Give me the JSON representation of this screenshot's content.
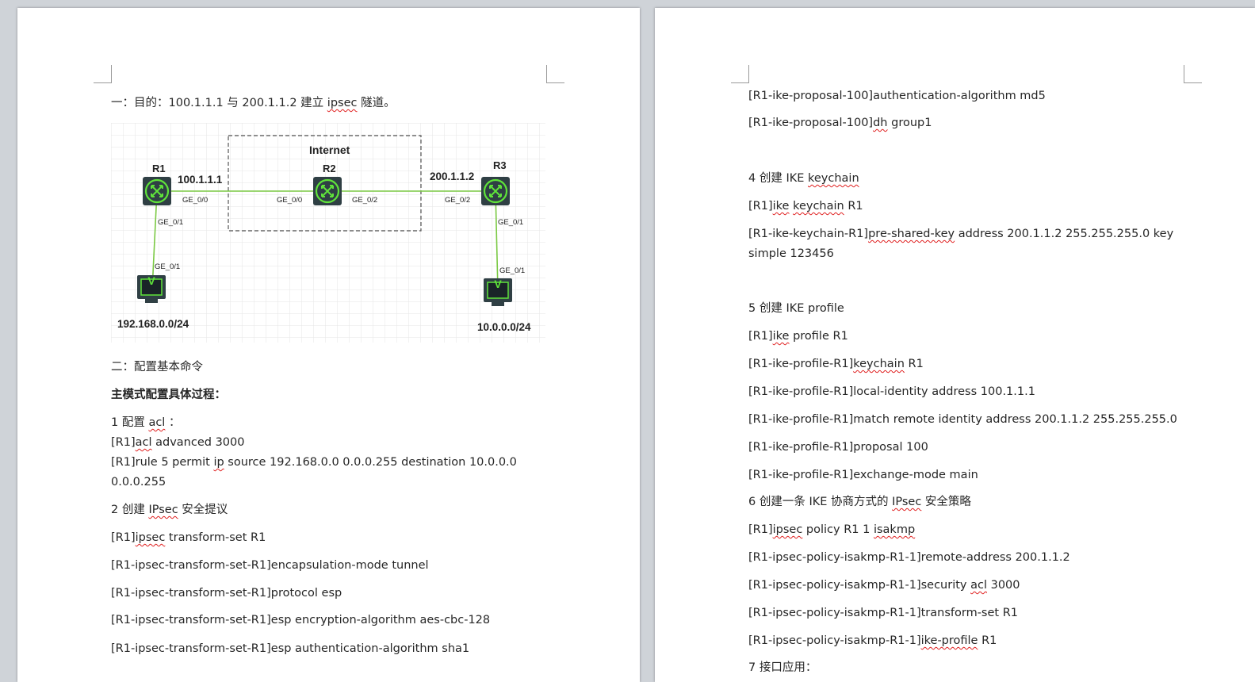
{
  "left_page": {
    "heading1": "一：目的：100.1.1.1 与 200.1.1.2 建立 ipsec 隧道。",
    "heading1_pre": "一：目的：100.1.1.1 与 200.1.1.2 建立 ",
    "heading1_word": "ipsec",
    "heading1_post": " 隧道。",
    "diagram": {
      "internet_label": "Internet",
      "routers": [
        {
          "name": "R1",
          "ip": "100.1.1.1"
        },
        {
          "name": "R2",
          "ip": ""
        },
        {
          "name": "R3",
          "ip": "200.1.1.2"
        }
      ],
      "port_labels": {
        "r1_up": "GE_0/0",
        "r2_left": "GE_0/0",
        "r2_right": "GE_0/2",
        "r3_up": "GE_0/2",
        "r1_down": "GE_0/1",
        "pc1_up": "GE_0/1",
        "r3_down": "GE_0/1",
        "pc2_up": "GE_0/1"
      },
      "pc_glyph": "V",
      "networks": [
        "192.168.0.0/24",
        "10.0.0.0/24"
      ]
    },
    "heading2": "二：配置基本命令",
    "heading3": "主模式配置具体过程：",
    "step1_pre": "1 配置 ",
    "step1_word": "acl",
    "step1_post": " ：",
    "cmd_acl_pre": "[R1]",
    "cmd_acl_word": "acl",
    "cmd_acl_post": " advanced  3000",
    "cmd_rule_pre": "[R1]rule 5 permit   ",
    "cmd_rule_word": "ip",
    "cmd_rule_post": " source 192.168.0.0 0.0.0.255 destination 10.0.0.0",
    "cmd_rule_cont": "0.0.0.255",
    "step2_pre": "2 创建 ",
    "step2_word": "IPsec",
    "step2_post": " 安全提议",
    "cmd_ts_pre": "[R1]",
    "cmd_ts_word": "ipsec",
    "cmd_ts_post": " transform-set R1",
    "cmd_encap": "[R1-ipsec-transform-set-R1]encapsulation-mode tunnel",
    "cmd_protocol": "[R1-ipsec-transform-set-R1]protocol esp",
    "cmd_enc": "[R1-ipsec-transform-set-R1]esp encryption-algorithm aes-cbc-128",
    "cmd_auth": "[R1-ipsec-transform-set-R1]esp authentication-algorithm sha1"
  },
  "right_page": {
    "r_auth": "[R1-ike-proposal-100]authentication-algorithm md5",
    "r_dh_pre": "[R1-ike-proposal-100]",
    "r_dh_word": "dh",
    "r_dh_post": " group1",
    "step4_pre": "4 创建 IKE ",
    "step4_word": "keychain",
    "r_kc_pre": "[R1]",
    "r_kc_w1": "ike",
    "r_kc_sp": " ",
    "r_kc_w2": "keychain",
    "r_kc_post": " R1",
    "r_psk_pre": "[R1-ike-keychain-R1]",
    "r_psk_word": "pre-shared-key",
    "r_psk_post": " address 200.1.1.2 255.255.255.0 key",
    "r_psk_cont": "simple 123456",
    "step5": "5 创建 IKE profile",
    "r_prof_pre": "[R1]",
    "r_prof_word": "ike",
    "r_prof_post": " profile R1",
    "r_pkc_pre": "[R1-ike-profile-R1]",
    "r_pkc_word": "keychain",
    "r_pkc_post": " R1",
    "r_local": "[R1-ike-profile-R1]local-identity address 100.1.1.1",
    "r_match": "[R1-ike-profile-R1]match remote identity address 200.1.1.2 255.255.255.0",
    "r_proposal": "[R1-ike-profile-R1]proposal 100",
    "r_exch": "[R1-ike-profile-R1]exchange-mode main",
    "step6_pre": " 6 创建一条 IKE 协商方式的 ",
    "step6_word": "IPsec",
    "step6_post": " 安全策略",
    "r_pol_pre": "[R1]",
    "r_pol_w1": "ipsec",
    "r_pol_mid": " policy  R1  1  ",
    "r_pol_w2": "isakmp",
    "r_remote": "[R1-ipsec-policy-isakmp-R1-1]remote-address 200.1.1.2",
    "r_sec_pre": "[R1-ipsec-policy-isakmp-R1-1]security ",
    "r_sec_word": "acl",
    "r_sec_post": " 3000",
    "r_tset": "[R1-ipsec-policy-isakmp-R1-1]transform-set R1",
    "r_ikep_pre": "[R1-ipsec-policy-isakmp-R1-1]",
    "r_ikep_word": "ike-profile",
    "r_ikep_post": " R1",
    "step7": "7 接口应用："
  },
  "colors": {
    "page_bg": "#ffffff",
    "canvas_bg": "#cfd3d8",
    "router_fill": "#2f3f44",
    "router_green": "#5fe33a",
    "link_green": "#7ac943",
    "squiggle": "#e02020"
  }
}
